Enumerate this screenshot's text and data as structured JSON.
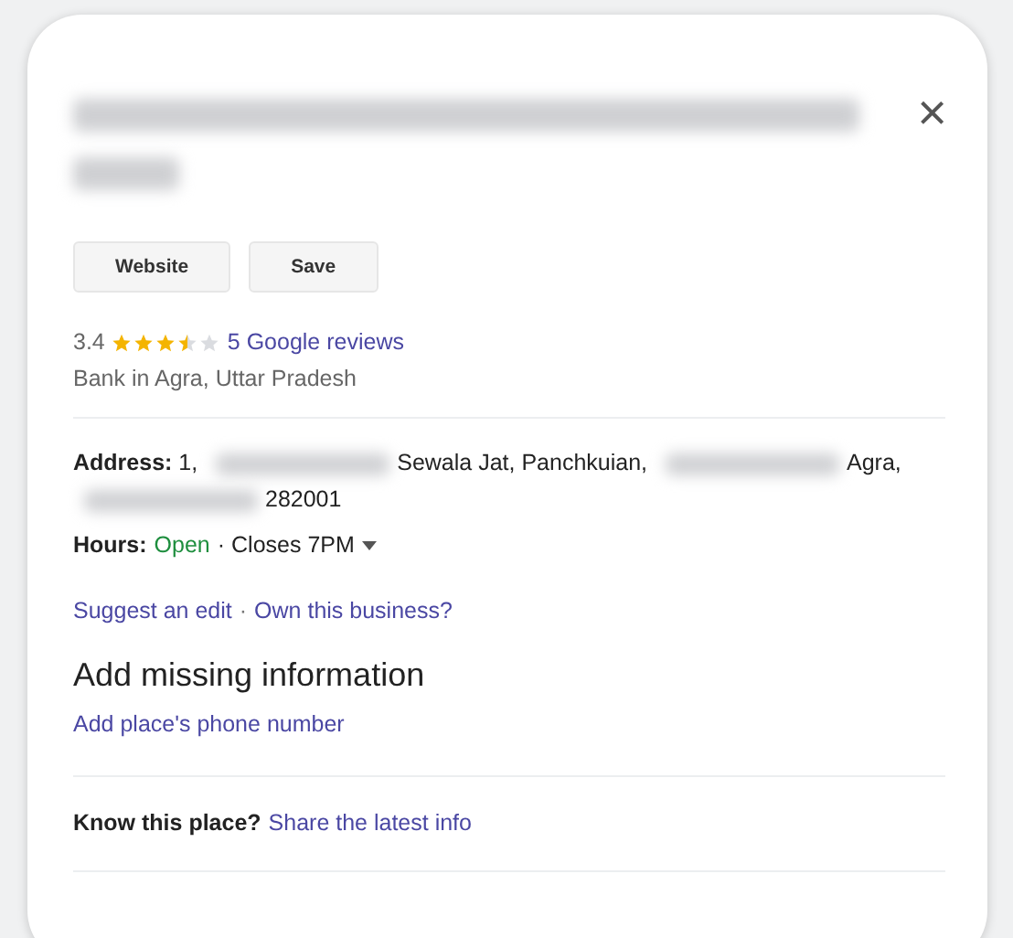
{
  "close": "×",
  "buttons": [
    {
      "label": "Website"
    },
    {
      "label": "Save"
    }
  ],
  "rating": {
    "score": "3.4",
    "stars": 3.5,
    "reviews": "5 Google reviews"
  },
  "category": "Bank in Agra, Uttar Pradesh",
  "address": {
    "label": "Address:",
    "parts": [
      {
        "kind": "text",
        "text": "1,"
      },
      {
        "kind": "redacted"
      },
      {
        "kind": "text",
        "text": "Sewala Jat, Panchkuian,"
      },
      {
        "kind": "redacted"
      },
      {
        "kind": "text",
        "text": "Agra,"
      },
      {
        "kind": "redacted"
      },
      {
        "kind": "text",
        "text": "282001"
      }
    ]
  },
  "hours": {
    "label": "Hours:",
    "status": "Open",
    "closes": "· Closes 7PM"
  },
  "links": [
    "Suggest an edit",
    "·",
    "Own this business?"
  ],
  "missing": {
    "heading": "Add missing information",
    "link": "Add place's phone number"
  },
  "know": {
    "label": "Know this place?",
    "link": "Share the latest info"
  }
}
